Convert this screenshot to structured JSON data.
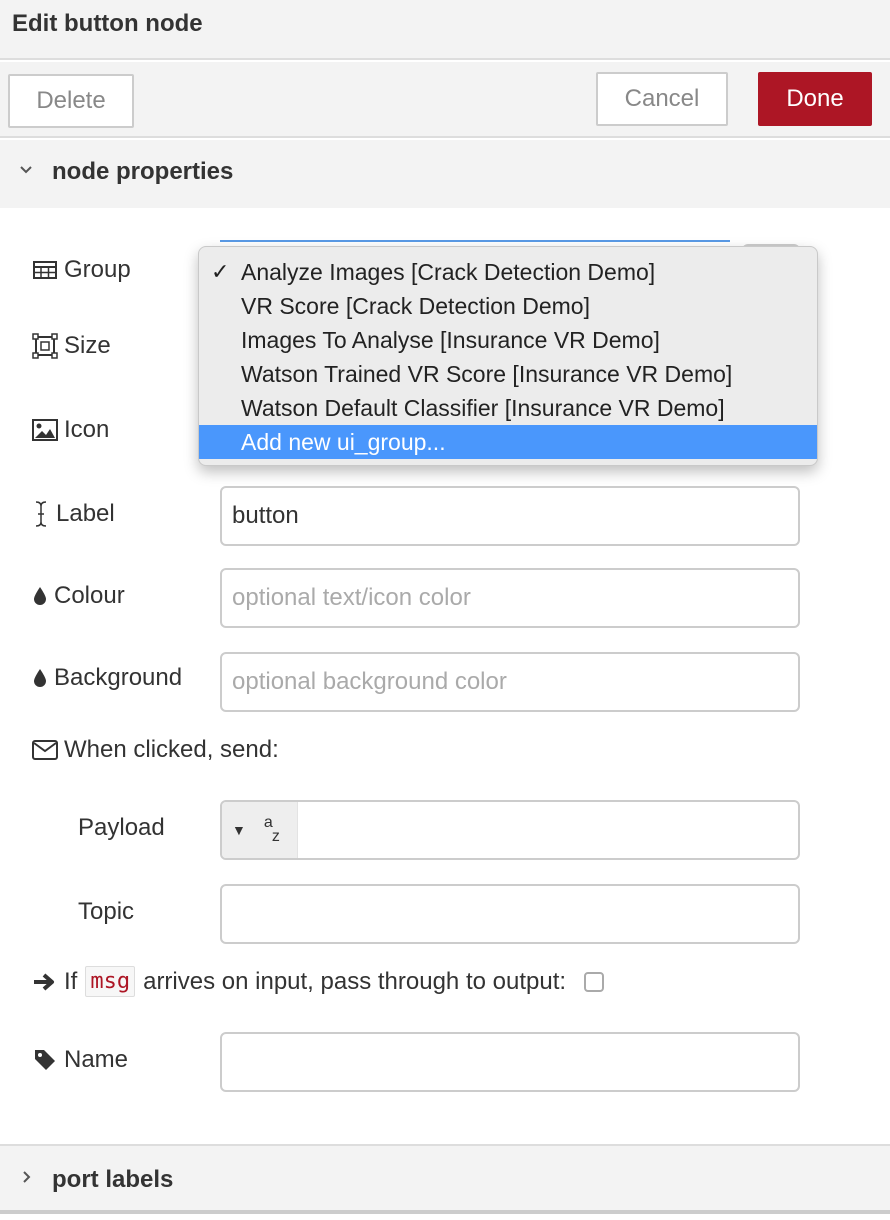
{
  "dialog": {
    "title": "Edit button node"
  },
  "toolbar": {
    "delete_label": "Delete",
    "cancel_label": "Cancel",
    "done_label": "Done"
  },
  "sections": {
    "node_properties": {
      "label": "node properties",
      "expanded": true
    },
    "port_labels": {
      "label": "port labels",
      "expanded": false
    }
  },
  "form": {
    "group": {
      "label": "Group",
      "icon": "table-icon"
    },
    "size": {
      "label": "Size",
      "icon": "resize-icon"
    },
    "icon": {
      "label": "Icon",
      "icon": "image-icon"
    },
    "label": {
      "label": "Label",
      "icon": "text-cursor-icon",
      "value": "button"
    },
    "colour": {
      "label": "Colour",
      "icon": "tint-icon",
      "value": "",
      "placeholder": "optional text/icon color"
    },
    "background": {
      "label": "Background",
      "icon": "tint-icon",
      "value": "",
      "placeholder": "optional background color"
    },
    "when_clicked": {
      "label": "When clicked, send:",
      "icon": "envelope-icon"
    },
    "payload": {
      "label": "Payload",
      "type_icon": "string-type-icon",
      "value": ""
    },
    "topic": {
      "label": "Topic",
      "value": ""
    },
    "passthrough": {
      "prefix": "If",
      "msg": "msg",
      "suffix": "arrives on input, pass through to output:",
      "checked": false
    },
    "name": {
      "label": "Name",
      "icon": "tag-icon",
      "value": ""
    }
  },
  "group_dropdown": {
    "selected": "Analyze Images [Crack Detection Demo]",
    "highlighted": "Add new ui_group...",
    "options": [
      "Analyze Images [Crack Detection Demo]",
      "VR Score [Crack Detection Demo]",
      "Images To Analyse [Insurance VR Demo]",
      "Watson Trained VR Score [Insurance VR Demo]",
      "Watson Default Classifier [Insurance VR Demo]",
      "Add new ui_group..."
    ]
  },
  "colors": {
    "accent": "#ad1625",
    "highlight": "#4a97fc",
    "panel": "#f3f3f3"
  }
}
